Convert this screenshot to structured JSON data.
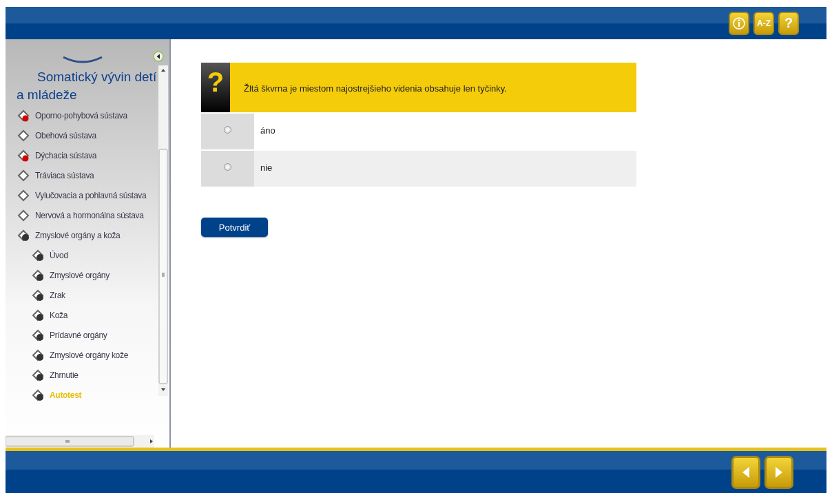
{
  "header": {
    "buttons": [
      {
        "kind": "info"
      },
      {
        "kind": "text",
        "label": "A-Z"
      },
      {
        "kind": "text",
        "label": "?"
      }
    ]
  },
  "sidebar": {
    "title": "Somatický vývin detí a mládeže",
    "items": [
      {
        "label": "Oporno-pohybová sústava",
        "kind": "marked",
        "selected": false
      },
      {
        "label": "Obehová sústava",
        "kind": "plain",
        "selected": false
      },
      {
        "label": "Dýchacia sústava",
        "kind": "marked",
        "selected": false
      },
      {
        "label": "Tráviaca sústava",
        "kind": "plain",
        "selected": false
      },
      {
        "label": "Vylučovacia a pohlavná sústava",
        "kind": "plain",
        "selected": false
      },
      {
        "label": "Nervová a hormonálna sústava",
        "kind": "plain",
        "selected": false
      },
      {
        "label": "Zmyslové orgány a koža",
        "kind": "ball",
        "selected": false,
        "children": [
          {
            "label": "Úvod",
            "kind": "ball",
            "selected": false
          },
          {
            "label": "Zmyslové orgány",
            "kind": "ball",
            "selected": false
          },
          {
            "label": "Zrak",
            "kind": "ball",
            "selected": false
          },
          {
            "label": "Koža",
            "kind": "ball",
            "selected": false
          },
          {
            "label": "Prídavné orgány",
            "kind": "ball",
            "selected": false
          },
          {
            "label": "Zmyslové orgány kože",
            "kind": "ball",
            "selected": false
          },
          {
            "label": "Zhrnutie",
            "kind": "ball",
            "selected": false
          },
          {
            "label": "Autotest",
            "kind": "ball",
            "selected": true
          }
        ]
      }
    ]
  },
  "quiz": {
    "icon": "?",
    "question": "Žltá škvrna je miestom najostrejšieho videnia obsahuje len tyčinky.",
    "options": [
      {
        "label": "áno",
        "selected": false
      },
      {
        "label": "nie",
        "selected": false
      }
    ],
    "confirm": "Potvrdiť"
  },
  "footer": {
    "buttons": [
      {
        "kind": "prev"
      },
      {
        "kind": "next"
      }
    ]
  }
}
